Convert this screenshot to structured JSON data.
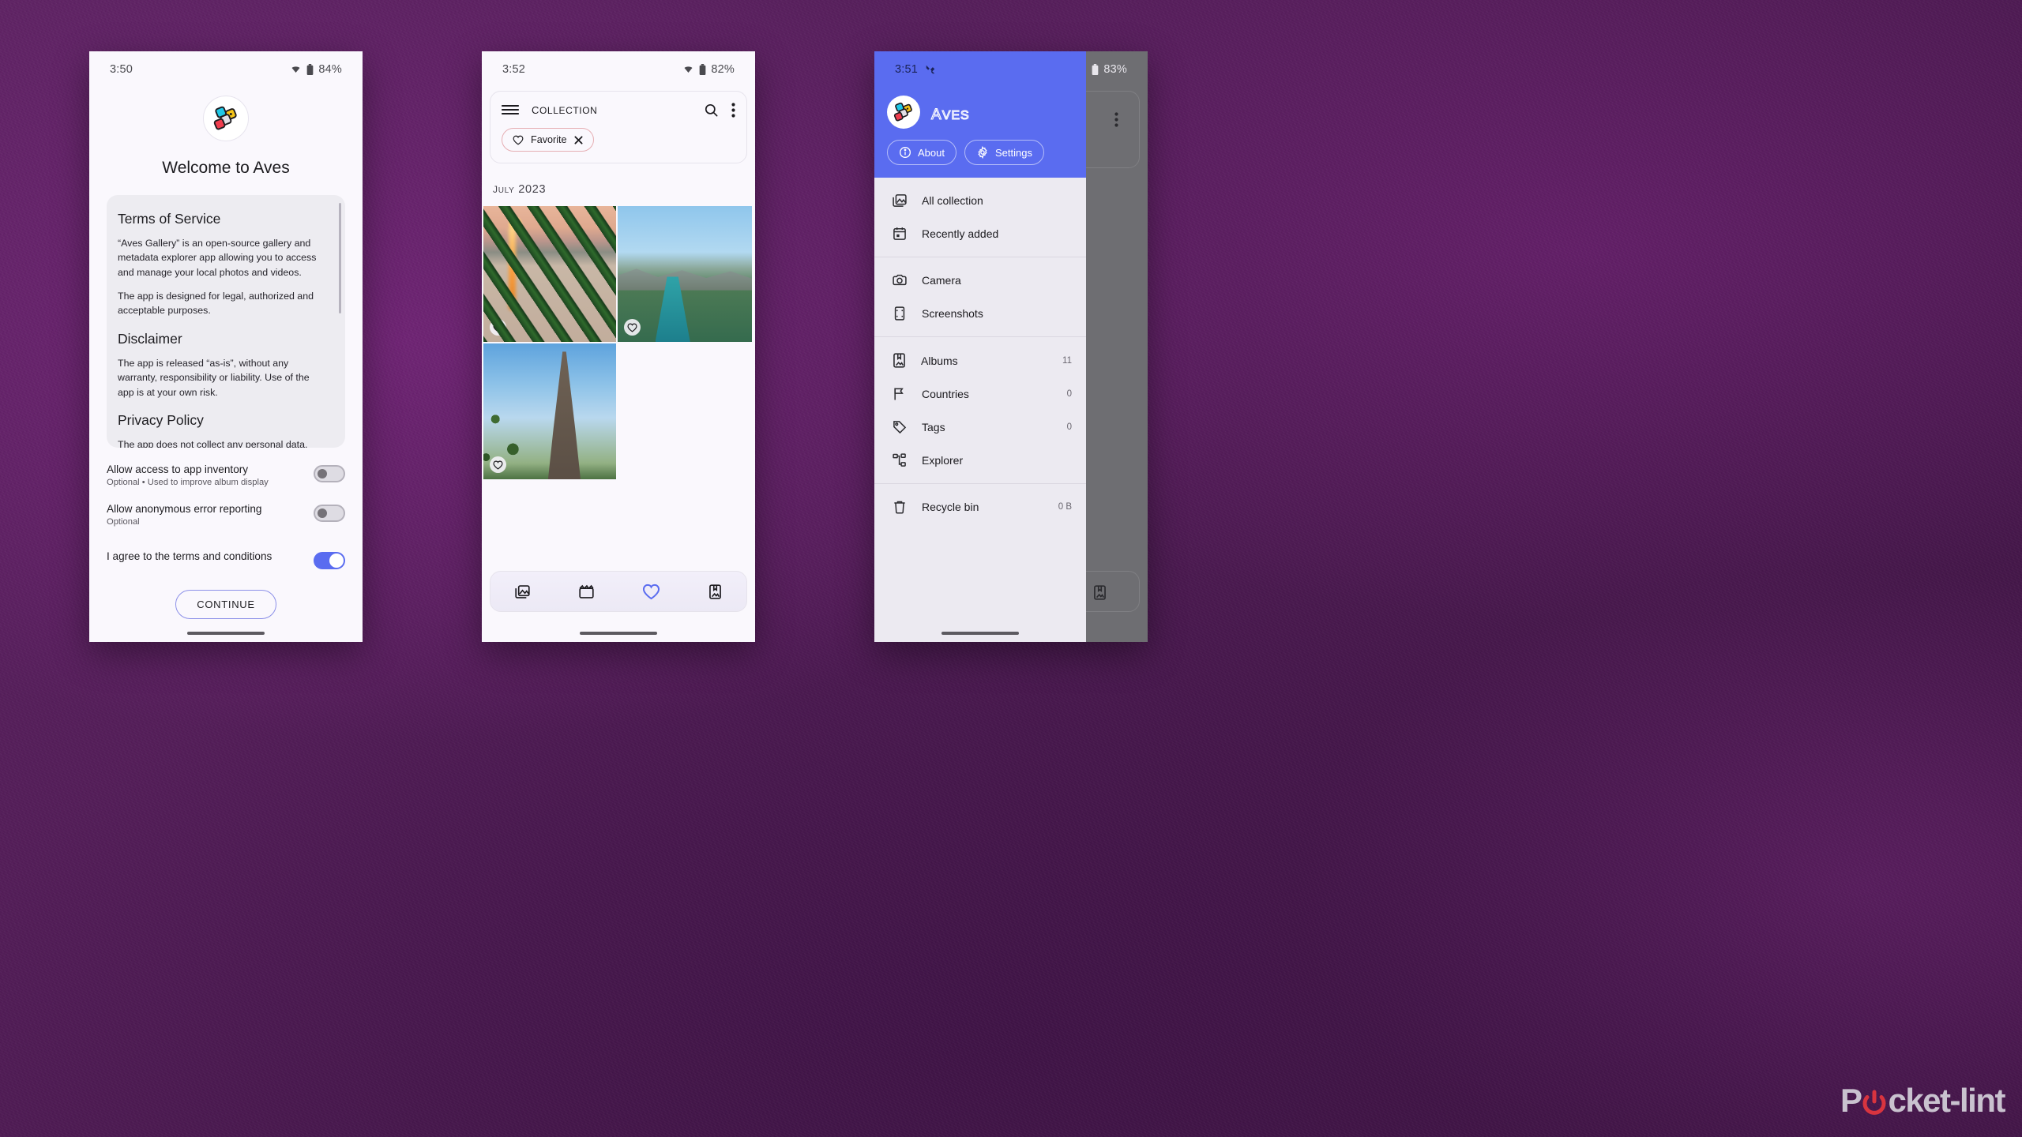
{
  "watermark": {
    "text_before": "P",
    "text_after": "cket-lint",
    "logo_icon": "power-icon"
  },
  "phone_onboarding": {
    "statusbar": {
      "time": "3:50",
      "wifi_icon": "wifi-icon",
      "battery_icon": "battery-icon",
      "battery": "84%"
    },
    "app_logo_icon": "aves-logo-icon",
    "title": "Welcome to Aves",
    "terms": {
      "sections": [
        {
          "heading": "Terms of Service",
          "paragraphs": [
            "“Aves Gallery” is an open-source gallery and metadata explorer app allowing you to access and manage your local photos and videos.",
            "The app is designed for legal, authorized and acceptable purposes."
          ]
        },
        {
          "heading": "Disclaimer",
          "paragraphs": [
            "The app is released “as-is”, without any warranty, responsibility or liability. Use of the app is at your own risk."
          ]
        },
        {
          "heading": "Privacy Policy",
          "paragraphs": [
            "The app does not collect any personal data. We never have access to your photos and videos. This also means that we cannot get them back for you if"
          ]
        }
      ]
    },
    "settings": [
      {
        "label": "Allow access to app inventory",
        "sub": "Optional • Used to improve album display",
        "state": "off"
      },
      {
        "label": "Allow anonymous error reporting",
        "sub": "Optional",
        "state": "off"
      },
      {
        "label": "I agree to the terms and conditions",
        "sub": "",
        "state": "on"
      }
    ],
    "continue_label": "CONTINUE"
  },
  "phone_collection": {
    "statusbar": {
      "time": "3:52",
      "wifi_icon": "wifi-icon",
      "battery_icon": "battery-icon",
      "battery": "82%"
    },
    "appbar": {
      "menu_icon": "hamburger-menu-icon",
      "title": "Collection",
      "search_icon": "search-icon",
      "overflow_icon": "more-vertical-icon"
    },
    "filter_chip": {
      "icon": "heart-outline-icon",
      "label": "Favorite",
      "remove_icon": "close-icon"
    },
    "section_date": "July 2023",
    "tiles": [
      {
        "name": "sunset-through-grass-photo",
        "favorite": true
      },
      {
        "name": "mostar-riverside-photo",
        "favorite": true
      },
      {
        "name": "eiffel-tower-photo",
        "favorite": true
      }
    ],
    "bottom_nav": [
      {
        "icon": "all-collection-icon",
        "active": false
      },
      {
        "icon": "videos-icon",
        "active": false
      },
      {
        "icon": "favorites-icon",
        "active": true
      },
      {
        "icon": "albums-icon",
        "active": false
      }
    ],
    "accent_color": "#5a6cf0"
  },
  "phone_drawer": {
    "statusbar": {
      "time": "3:51",
      "cast_icon": "cast-icon",
      "wifi_icon": "wifi-icon",
      "battery_icon": "battery-icon",
      "battery": "83%"
    },
    "header": {
      "brand_logo_icon": "aves-logo-icon",
      "brand_name": "Aves",
      "about": {
        "icon": "info-circle-icon",
        "label": "About"
      },
      "settings": {
        "icon": "gear-icon",
        "label": "Settings"
      },
      "bg_color": "#5a6cf0"
    },
    "groups": [
      {
        "items": [
          {
            "icon": "all-collection-icon",
            "label": "All collection",
            "count": ""
          },
          {
            "icon": "calendar-icon",
            "label": "Recently added",
            "count": ""
          }
        ]
      },
      {
        "items": [
          {
            "icon": "camera-icon",
            "label": "Camera",
            "count": ""
          },
          {
            "icon": "screenshots-icon",
            "label": "Screenshots",
            "count": ""
          }
        ]
      },
      {
        "items": [
          {
            "icon": "albums-icon",
            "label": "Albums",
            "count": "11"
          },
          {
            "icon": "flag-icon",
            "label": "Countries",
            "count": "0"
          },
          {
            "icon": "tag-icon",
            "label": "Tags",
            "count": "0"
          },
          {
            "icon": "explorer-icon",
            "label": "Explorer",
            "count": ""
          }
        ]
      },
      {
        "items": [
          {
            "icon": "trash-icon",
            "label": "Recycle bin",
            "count": "0 B"
          }
        ]
      }
    ],
    "background_appbar": {
      "search_icon": "search-icon",
      "overflow_icon": "more-vertical-icon"
    }
  }
}
